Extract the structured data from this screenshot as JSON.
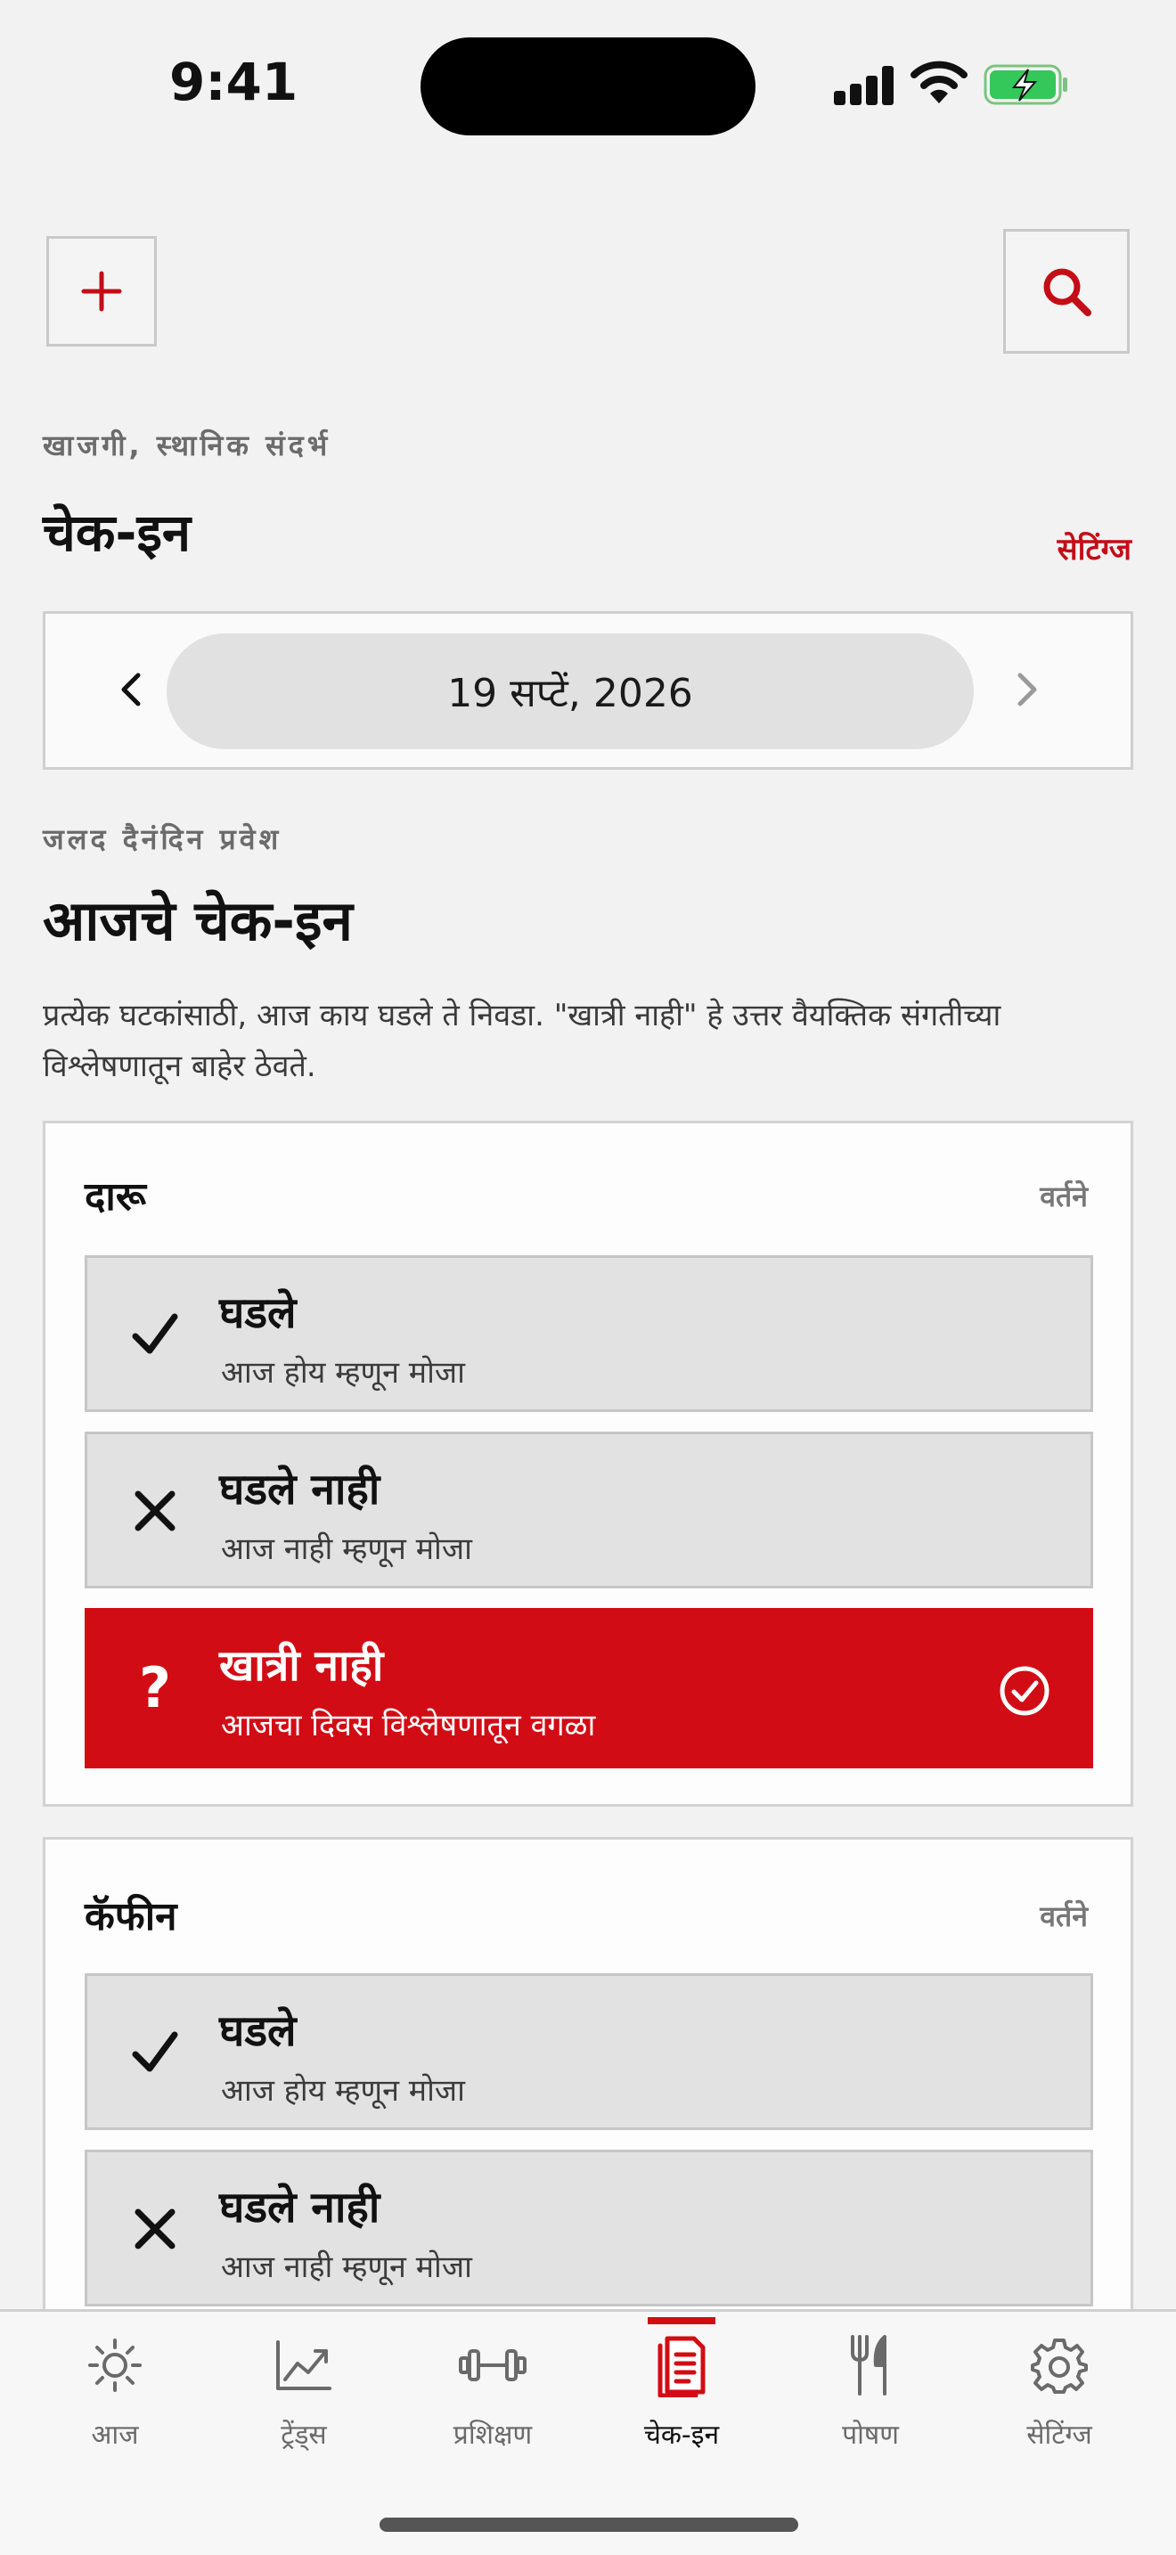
{
  "status_bar": {
    "time": "9:41"
  },
  "top": {
    "eyebrow": "खाजगी, स्थानिक संदर्भ",
    "title": "चेक-इन",
    "settings_link": "सेटिंग्ज"
  },
  "date_selector": {
    "date": "19 सप्टें, 2026"
  },
  "section": {
    "eyebrow": "जलद दैनंदिन प्रवेश",
    "title": "आजचे चेक-इन",
    "description": "प्रत्येक घटकांसाठी, आज काय घडले ते निवडा. \"खात्री नाही\" हे उत्तर वैयक्तिक संगतीच्या विश्लेषणातून बाहेर ठेवते."
  },
  "factors": [
    {
      "name": "दारू",
      "tag": "वर्तने",
      "options": [
        {
          "title": "घडले",
          "subtitle": "आज होय म्हणून मोजा",
          "icon": "checkmark-icon",
          "selected": false
        },
        {
          "title": "घडले नाही",
          "subtitle": "आज नाही म्हणून मोजा",
          "icon": "x-icon",
          "selected": false
        },
        {
          "title": "खात्री नाही",
          "subtitle": "आजचा दिवस विश्लेषणातून वगळा",
          "icon": "question-icon",
          "selected": true
        }
      ]
    },
    {
      "name": "कॅफीन",
      "tag": "वर्तने",
      "options": [
        {
          "title": "घडले",
          "subtitle": "आज होय म्हणून मोजा",
          "icon": "checkmark-icon",
          "selected": false
        },
        {
          "title": "घडले नाही",
          "subtitle": "आज नाही म्हणून मोजा",
          "icon": "x-icon",
          "selected": false
        }
      ]
    }
  ],
  "tabs": [
    {
      "label": "आज",
      "icon": "sun-icon"
    },
    {
      "label": "ट्रेंड्स",
      "icon": "trend-chart-icon"
    },
    {
      "label": "प्रशिक्षण",
      "icon": "dumbbell-icon"
    },
    {
      "label": "चेक-इन",
      "icon": "clipboard-icon",
      "active": true
    },
    {
      "label": "पोषण",
      "icon": "fork-knife-icon"
    },
    {
      "label": "सेटिंग्ज",
      "icon": "gear-icon"
    }
  ],
  "colors": {
    "accent": "#d20c15",
    "background": "#f2f2f2"
  }
}
